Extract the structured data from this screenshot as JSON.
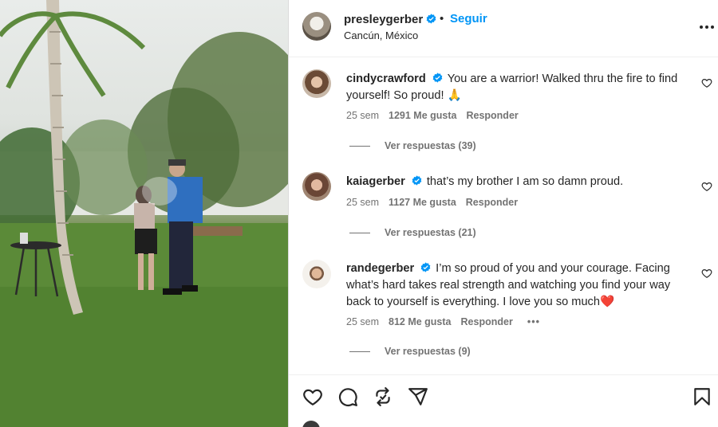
{
  "post": {
    "username": "presleygerber",
    "dot": "•",
    "follow_label": "Seguir",
    "location": "Cancún, México",
    "more_icon": "more-horizontal-icon"
  },
  "comments": [
    {
      "username": "cindycrawford",
      "text": "You are a warrior! Walked thru the fire to find yourself! So proud! 🙏",
      "time": "25 sem",
      "likes": "1291 Me gusta",
      "reply": "Responder",
      "view_replies": "Ver respuestas (39)"
    },
    {
      "username": "kaiagerber",
      "text": "that’s my brother I am so damn proud.",
      "time": "25 sem",
      "likes": "1127 Me gusta",
      "reply": "Responder",
      "view_replies": "Ver respuestas (21)"
    },
    {
      "username": "randegerber",
      "text": "I’m so proud of you and your courage. Facing what’s hard takes real strength and watching you find your way back to yourself is everything. I love you so much❤️",
      "time": "25 sem",
      "likes": "812 Me gusta",
      "reply": "Responder",
      "options": "•••",
      "view_replies": "Ver respuestas (9)"
    }
  ],
  "actions": {
    "like_icon": "heart-icon",
    "comment_icon": "comment-icon",
    "repost_icon": "repost-icon",
    "share_icon": "share-icon",
    "save_icon": "bookmark-icon"
  },
  "colors": {
    "accent": "#0095f6",
    "verified": "#0095f6",
    "text": "#262626",
    "muted": "#737373"
  }
}
